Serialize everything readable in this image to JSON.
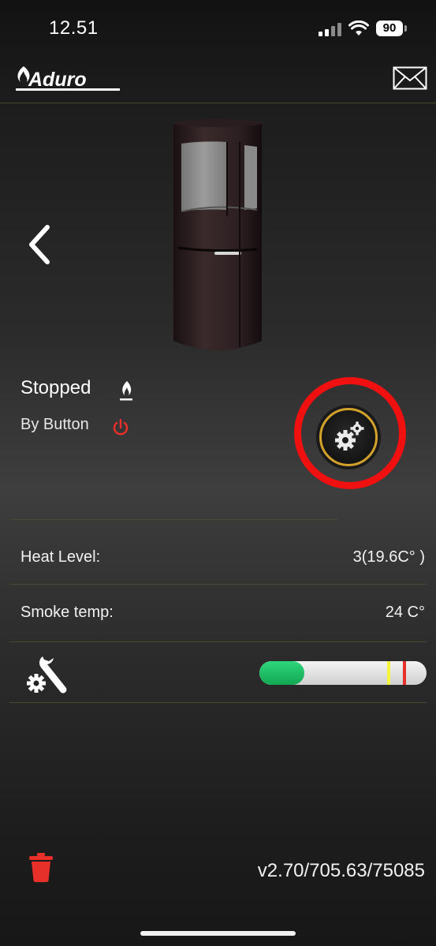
{
  "status_bar": {
    "time": "12.51",
    "battery": "90",
    "icons": [
      "cellular-signal-icon",
      "wifi-icon",
      "battery-icon"
    ]
  },
  "header": {
    "logo_text": "Aduro",
    "icons": [
      "aduro-logo",
      "mail-icon"
    ]
  },
  "stove": {
    "status": "Stopped",
    "status_icon": "flame-icon",
    "reason": "By Button",
    "reason_icon": "power-icon"
  },
  "nav": {
    "back_icon": "chevron-left-icon",
    "settings_icon": "gears-icon"
  },
  "readings": [
    {
      "label": "Heat Level:",
      "value": "3(19.6C° )"
    },
    {
      "label": "Smoke temp:",
      "value": "24 C°"
    }
  ],
  "maintenance": {
    "icon": "wrench-gear-icon",
    "gauge_fill_fraction": 0.27,
    "gauge_markers": [
      "#f5f53a",
      "#e8302a"
    ],
    "gauge_colors": {
      "fill": "#1cc064",
      "track": "#d8d8d8"
    }
  },
  "footer": {
    "delete_icon": "trash-icon",
    "version": "v2.70/705.63/75085"
  },
  "colors": {
    "accent_ring": "#d4a22a",
    "highlight": "#f01010",
    "alert_red": "#e8302a",
    "divider": "#4a4a32"
  }
}
